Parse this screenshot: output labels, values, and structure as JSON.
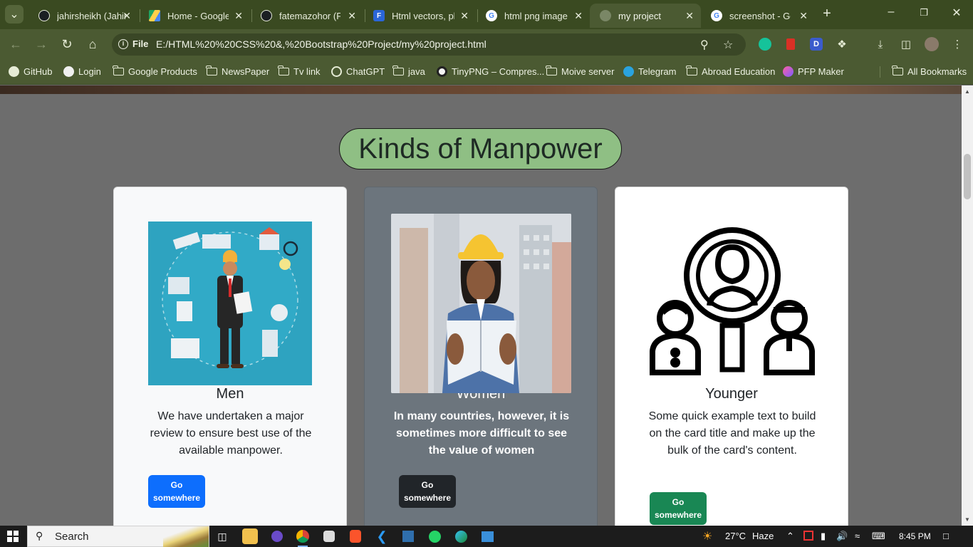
{
  "browser": {
    "tabs": [
      {
        "title": "jahirsheikh (Jahir",
        "icon": "github-icon",
        "active": false
      },
      {
        "title": "Home - Google",
        "icon": "google-drive-icon",
        "active": false
      },
      {
        "title": "fatemazohor (Fa",
        "icon": "github-icon",
        "active": false
      },
      {
        "title": "Html vectors, ph",
        "icon": "freepik-icon",
        "active": false
      },
      {
        "title": "html png image",
        "icon": "google-icon",
        "active": false
      },
      {
        "title": "my project",
        "icon": "globe-icon",
        "active": true
      },
      {
        "title": "screenshot - Goo",
        "icon": "google-icon",
        "active": false
      }
    ],
    "omnibox": {
      "scheme_label": "File",
      "url": "E:/HTML%20%20CSS%20&,%20Bootstrap%20Project/my%20project.html"
    },
    "bookmarks": [
      {
        "label": "GitHub",
        "icon": "github-icon"
      },
      {
        "label": "Login",
        "icon": "login-icon"
      },
      {
        "label": "Google Products",
        "icon": "folder-icon"
      },
      {
        "label": "NewsPaper",
        "icon": "folder-icon"
      },
      {
        "label": "Tv link",
        "icon": "folder-icon"
      },
      {
        "label": "ChatGPT",
        "icon": "chatgpt-icon"
      },
      {
        "label": "java",
        "icon": "folder-icon"
      },
      {
        "label": "TinyPNG – Compres...",
        "icon": "panda-icon"
      },
      {
        "label": "Moive server",
        "icon": "folder-icon"
      },
      {
        "label": "Telegram",
        "icon": "telegram-icon"
      },
      {
        "label": "Abroad Education",
        "icon": "folder-icon"
      },
      {
        "label": "PFP Maker",
        "icon": "pfp-icon"
      }
    ],
    "all_bookmarks_label": "All Bookmarks"
  },
  "page": {
    "section_title": "Kinds of Manpower",
    "cards": [
      {
        "title": "Men",
        "text": "We have undertaken a major review to ensure best use of the available manpower.",
        "button": "Go somewhere",
        "button_color": "#0d6efd"
      },
      {
        "title": "Women",
        "text": "In many countries, however, it is sometimes more difficult to see the value of women",
        "button": "Go somewhere",
        "button_color": "#212529"
      },
      {
        "title": "Younger",
        "text": "Some quick example text to build on the card title and make up the bulk of the card's content.",
        "button": "Go somewhere",
        "button_color": "#198754"
      }
    ]
  },
  "taskbar": {
    "search_label": "Search",
    "weather": "27°C",
    "weather_desc": "Haze",
    "time": "8:45 PM"
  },
  "colors": {
    "title_pill": "#8fbf84",
    "chrome_frame": "#3a4a21",
    "toolbar": "#4b5a32"
  }
}
